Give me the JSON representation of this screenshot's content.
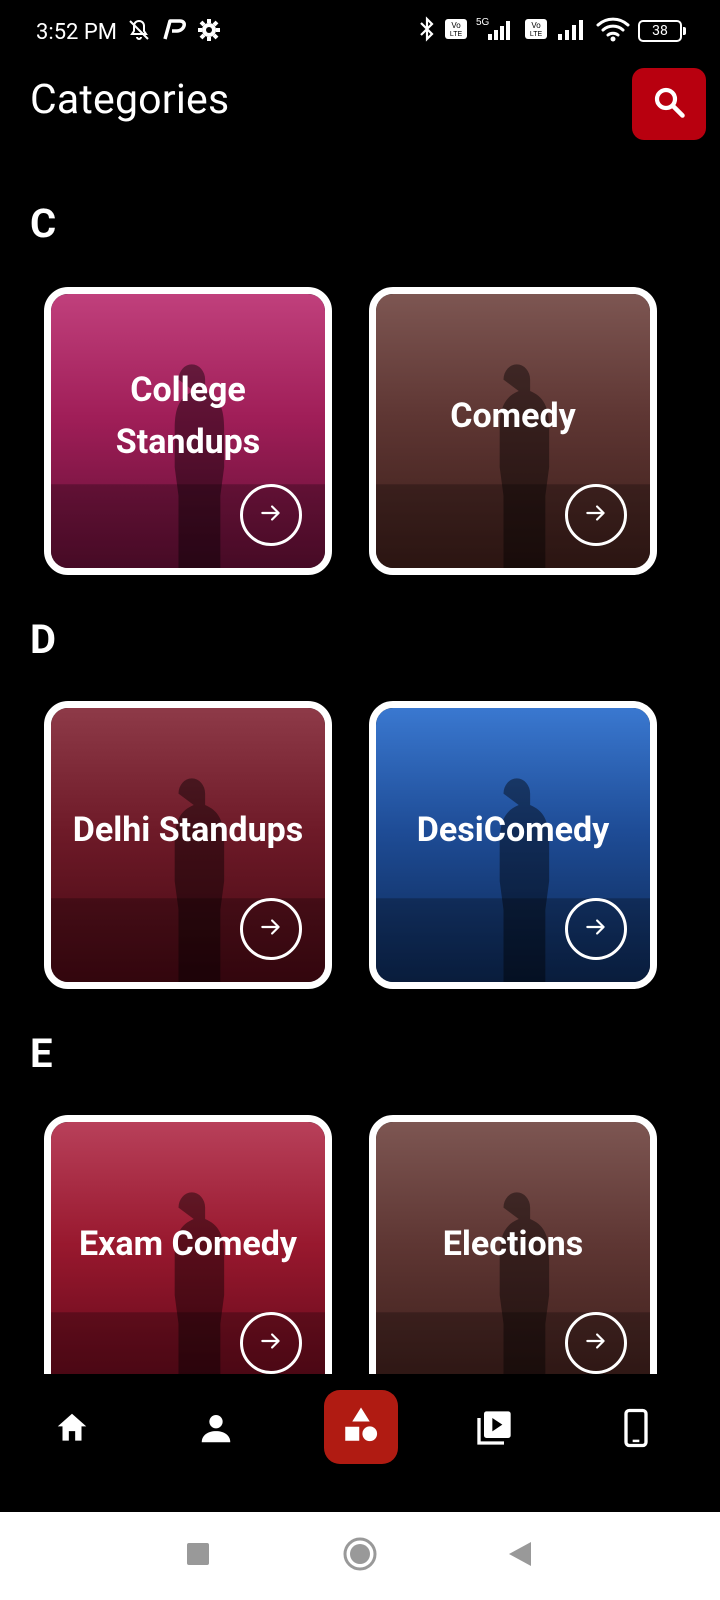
{
  "status_bar": {
    "time": "3:52 PM",
    "battery": "38",
    "icons": [
      "mute-bell-icon",
      "paytm-icon",
      "settings-gear-icon",
      "bluetooth-icon",
      "volte-icon",
      "5g-signal-icon",
      "volte-icon",
      "signal-icon",
      "wifi-icon",
      "battery-icon"
    ]
  },
  "header": {
    "title": "Categories",
    "search_icon": "search-icon"
  },
  "sections": [
    {
      "letter": "C",
      "cards": [
        {
          "title": "College Standups",
          "color": "#b01e5a"
        },
        {
          "title": "Comedy",
          "color": "#6b3a36"
        }
      ]
    },
    {
      "letter": "D",
      "cards": [
        {
          "title": "Delhi Standups",
          "color": "#7a1a28"
        },
        {
          "title": "DesiComedy",
          "color": "#1d4f9a"
        }
      ]
    },
    {
      "letter": "E",
      "cards": [
        {
          "title": "Exam Comedy",
          "color": "#9c1a32"
        },
        {
          "title": "Elections",
          "color": "#6b3a36"
        }
      ]
    }
  ],
  "bottom_nav": {
    "items": [
      "home-icon",
      "profile-icon",
      "categories-icon",
      "video-library-icon",
      "phone-icon"
    ],
    "active": "categories-icon",
    "accent": "#b01b12"
  },
  "system_nav": [
    "recents-icon",
    "home-circle-icon",
    "back-icon"
  ]
}
